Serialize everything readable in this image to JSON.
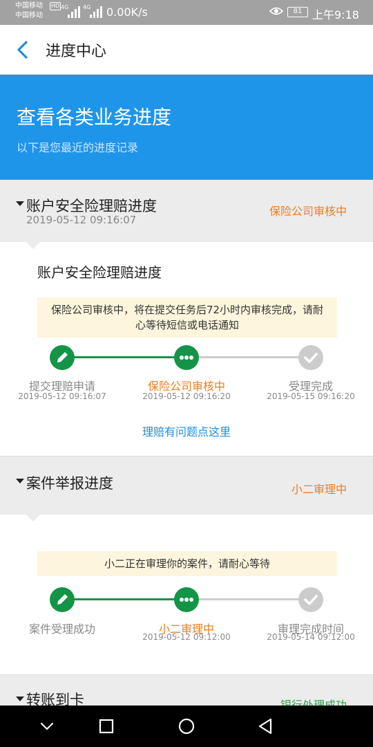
{
  "status_bar": {
    "carrier1": "中国移动",
    "carrier2": "中国移动",
    "hd": "HD",
    "net1": "4G",
    "net2": "4G",
    "speed": "0.00K/s",
    "battery": "81",
    "time": "上午9:18"
  },
  "nav": {
    "title": "进度中心"
  },
  "hero": {
    "title": "查看各类业务进度",
    "subtitle": "以下是您最近的进度记录"
  },
  "sections": [
    {
      "title": "账户安全险理赔进度",
      "date": "2019-05-12 09:16:07",
      "status": "保险公司审核中",
      "status_color": "#f07c1a",
      "card_title": "账户安全险理赔进度",
      "notice": "保险公司审核中，将在提交任务后72小时内审核完成，请耐心等待短信或电话通知",
      "steps": [
        {
          "label": "提交理赔申请",
          "date": "2019-05-12 09:16:07",
          "state": "done",
          "icon": "pencil-icon"
        },
        {
          "label": "保险公司审核中",
          "date": "2019-05-12 09:16:20",
          "state": "current",
          "icon": "dots-icon"
        },
        {
          "label": "受理完成",
          "date": "2019-05-15 09:16:20",
          "state": "pending",
          "icon": "check-icon"
        }
      ],
      "link": "理赔有问题点这里"
    },
    {
      "title": "案件举报进度",
      "status": "小二审理中",
      "status_color": "#f07c1a",
      "notice": "小二正在审理你的案件，请耐心等待",
      "steps": [
        {
          "label": "案件受理成功",
          "date": "",
          "state": "done",
          "icon": "pencil-icon"
        },
        {
          "label": "小二审理中",
          "date": "2019-05-12 09:12:00",
          "state": "current",
          "icon": "dots-icon"
        },
        {
          "label": "审理完成时间",
          "date": "2019-05-14 09:12:00",
          "state": "pending",
          "icon": "check-icon"
        }
      ]
    },
    {
      "title": "转账到卡",
      "status": "银行处理成功",
      "status_color": "#2ea24c"
    }
  ],
  "colors": {
    "accent_blue": "#1f95ea",
    "done_green": "#139447",
    "pending_gray": "#cccccc",
    "orange": "#f07c1a"
  }
}
